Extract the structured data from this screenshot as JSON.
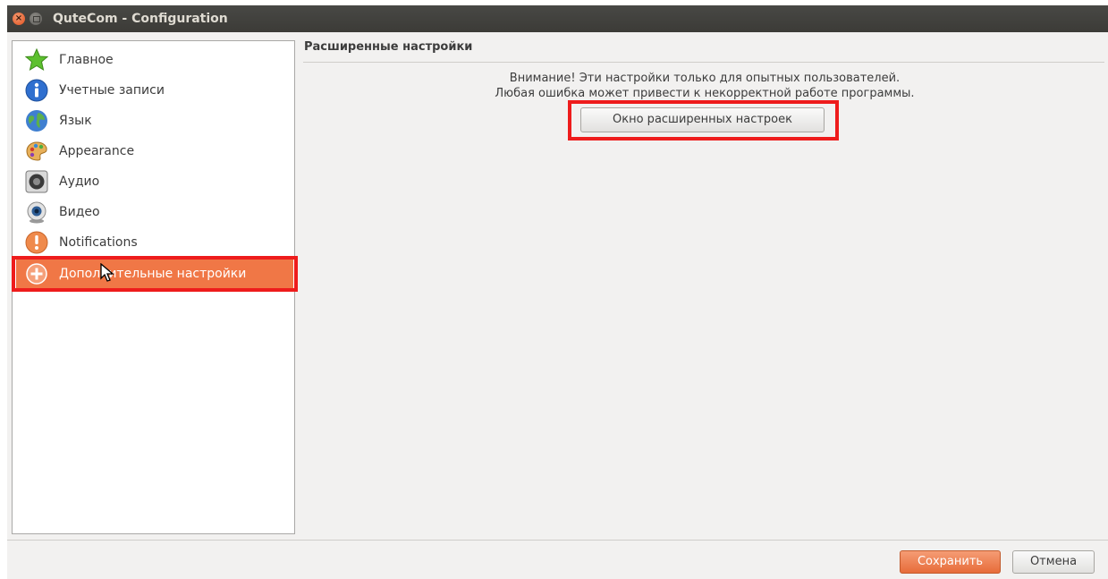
{
  "window": {
    "title": "QuteCom - Configuration",
    "close_glyph": "×"
  },
  "sidebar": {
    "items": [
      {
        "label": "Главное",
        "icon": "star-icon"
      },
      {
        "label": "Учетные записи",
        "icon": "info-icon"
      },
      {
        "label": "Язык",
        "icon": "globe-icon"
      },
      {
        "label": "Appearance",
        "icon": "palette-icon"
      },
      {
        "label": "Аудио",
        "icon": "speaker-icon"
      },
      {
        "label": "Видео",
        "icon": "webcam-icon"
      },
      {
        "label": "Notifications",
        "icon": "warning-icon"
      },
      {
        "label": "Дополнительные настройки",
        "icon": "plus-circle-icon",
        "selected": true
      }
    ]
  },
  "content": {
    "title": "Расширенные настройки",
    "warning_line1": "Внимание! Эти настройки только для опытных пользователей.",
    "warning_line2": "Любая ошибка может привести к некорректной работе программы.",
    "advanced_button_label": "Окно расширенных настроек"
  },
  "footer": {
    "save_label": "Сохранить",
    "cancel_label": "Отмена"
  },
  "colors": {
    "accent": "#f07746",
    "highlight_outline": "#ee1c1c",
    "titlebar": "#3c3b37"
  }
}
